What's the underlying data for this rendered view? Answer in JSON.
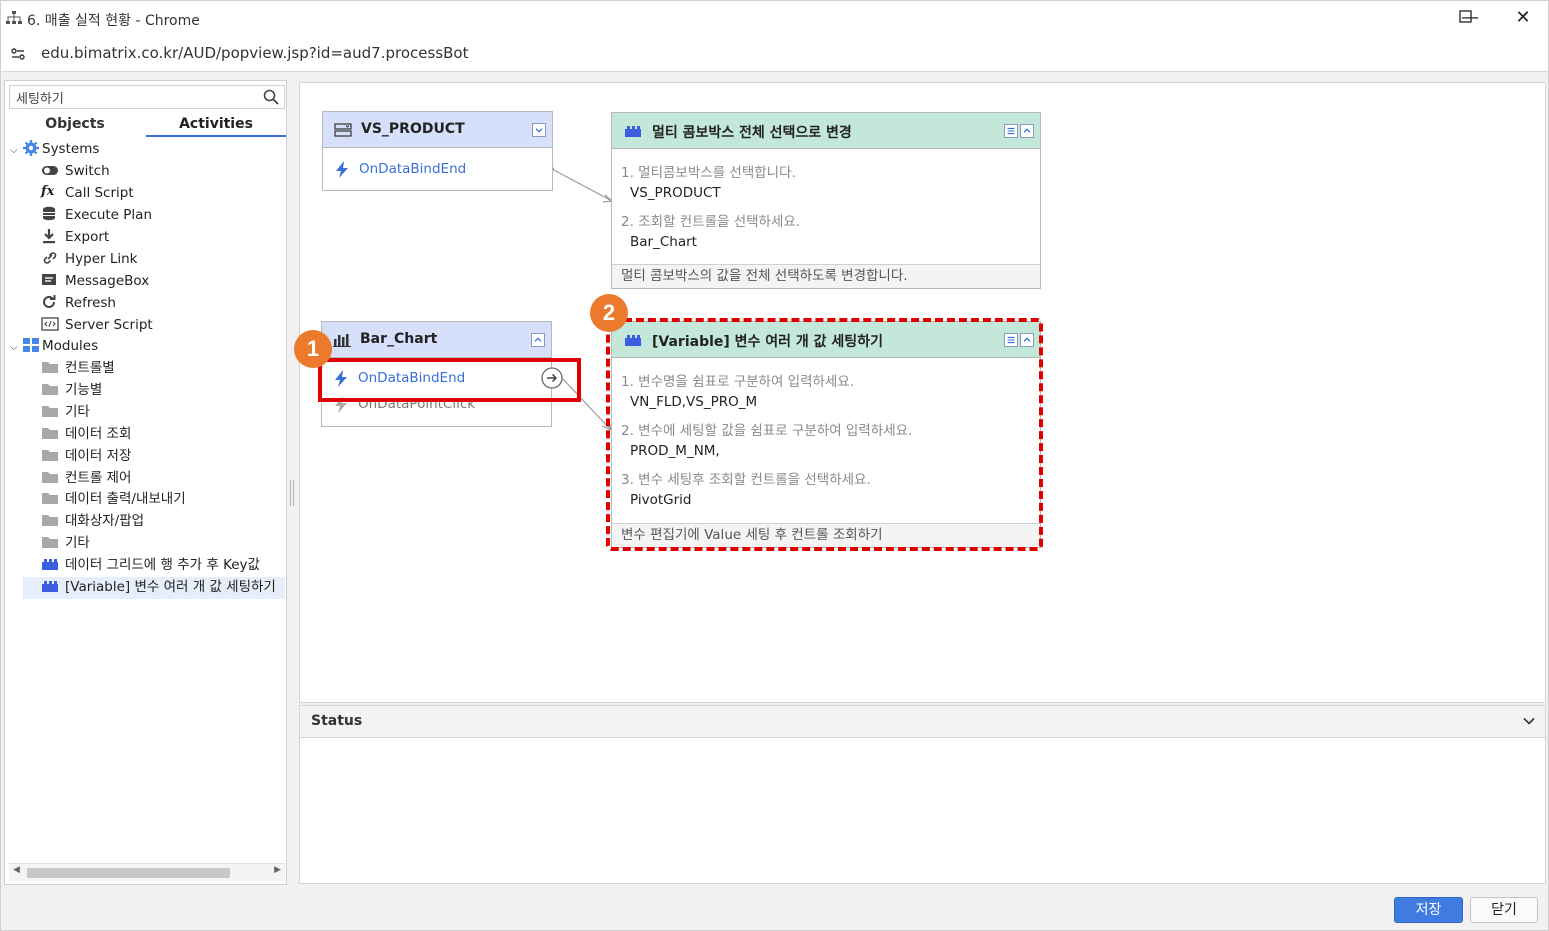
{
  "window": {
    "title": "6. 매출 실적 현황 - Chrome",
    "url": "edu.bimatrix.co.kr/AUD/popview.jsp?id=aud7.processBot",
    "minimize": "—",
    "maximize": "☐",
    "close": "✕"
  },
  "left": {
    "search_value": "세팅하기",
    "tabs": [
      {
        "label": "Objects",
        "active": false
      },
      {
        "label": "Activities",
        "active": true
      }
    ],
    "tree": {
      "systems": {
        "label": "Systems",
        "items": [
          {
            "label": "Switch",
            "icon": "toggle-icon"
          },
          {
            "label": "Call Script",
            "icon": "function-icon"
          },
          {
            "label": "Execute Plan",
            "icon": "database-icon"
          },
          {
            "label": "Export",
            "icon": "download-icon"
          },
          {
            "label": "Hyper Link",
            "icon": "link-icon"
          },
          {
            "label": "MessageBox",
            "icon": "message-icon"
          },
          {
            "label": "Refresh",
            "icon": "refresh-icon"
          },
          {
            "label": "Server Script",
            "icon": "code-icon"
          }
        ]
      },
      "modules": {
        "label": "Modules",
        "items": [
          {
            "label": "컨트롤별",
            "icon": "folder-icon"
          },
          {
            "label": "기능별",
            "icon": "folder-icon"
          },
          {
            "label": "기타",
            "icon": "folder-icon"
          },
          {
            "label": "데이터 조회",
            "icon": "folder-icon"
          },
          {
            "label": "데이터 저장",
            "icon": "folder-icon"
          },
          {
            "label": "컨트롤 제어",
            "icon": "folder-icon"
          },
          {
            "label": "데이터 출력/내보내기",
            "icon": "folder-icon"
          },
          {
            "label": "대화상자/팝업",
            "icon": "folder-icon"
          },
          {
            "label": "기타",
            "icon": "folder-icon"
          },
          {
            "label": "데이터 그리드에 행 추가 후 Key값",
            "icon": "module-icon"
          },
          {
            "label": "[Variable] 변수 여러 개 값 세팅하기",
            "icon": "module-icon",
            "selected": true
          }
        ]
      }
    }
  },
  "canvas": {
    "vs_product": {
      "title": "VS_PRODUCT",
      "events": [
        "OnDataBindEnd"
      ]
    },
    "bar_chart": {
      "title": "Bar_Chart",
      "events": [
        "OnDataBindEnd",
        "OnDataPointClick"
      ]
    },
    "action1": {
      "title": "멀티 콤보박스 전체 선택으로 변경",
      "q1": "1. 멀티콤보박스를 선택합니다.",
      "v1": "VS_PRODUCT",
      "q2": "2. 조회할 컨트롤을 선택하세요.",
      "v2": "Bar_Chart",
      "footer": "멀티 콤보박스의 값을 전체 선택하도록 변경합니다."
    },
    "action2": {
      "title": "[Variable] 변수 여러 개 값 세팅하기",
      "q1": "1. 변수명을 쉼표로 구분하여 입력하세요.",
      "v1": "VN_FLD,VS_PRO_M",
      "q2": "2. 변수에 세팅할 값을 쉼표로 구분하여 입력하세요.",
      "v2": "PROD_M_NM,",
      "q3": "3. 변수 세팅후 조회할 컨트롤을 선택하세요.",
      "v3": "PivotGrid",
      "footer": "변수 편집기에 Value 세팅 후 컨트롤 조회하기"
    },
    "callouts": [
      "1",
      "2"
    ]
  },
  "status": {
    "title": "Status"
  },
  "buttons": {
    "save": "저장",
    "close": "닫기"
  },
  "colors": {
    "accent": "#3a6fd8",
    "object_header": "#d6e0fa",
    "action_header": "#c3e8da",
    "callout": "#ec7a2d",
    "highlight": "#e00000"
  }
}
